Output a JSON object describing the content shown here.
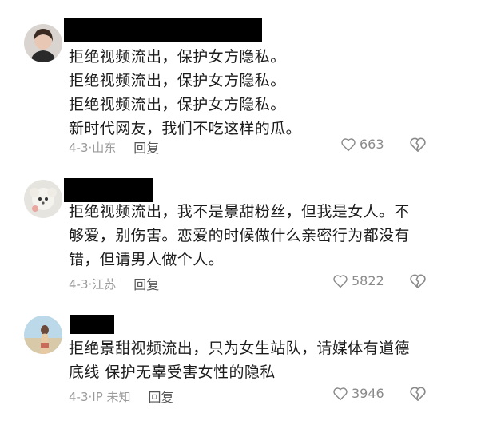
{
  "comments": [
    {
      "lines": "拒绝视频流出，保护女方隐私。\n拒绝视频流出，保护女方隐私。\n拒绝视频流出，保护女方隐私。\n新时代网友，我们不吃这样的瓜。",
      "date": "4-3·山东",
      "reply": "回复",
      "likes": "663"
    },
    {
      "lines": "拒绝视频流出，我不是景甜粉丝，但我是女人。不\n够爱，别伤害。恋爱的时候做什么亲密行为都没有\n错，但请男人做个人。",
      "date": "4-3·江苏",
      "reply": "回复",
      "likes": "5822"
    },
    {
      "lines": "拒绝景甜视频流出，只为女生站队，请媒体有道德\n底线 保护无辜受害女性的隐私",
      "date": "4-3·IP 未知",
      "reply": "回复",
      "likes": "3946"
    }
  ],
  "icons": {
    "like": "heart-outline-icon",
    "dislike": "broken-heart-icon"
  },
  "colors": {
    "meta_text": "#9a9a9a",
    "redaction": "#000000"
  }
}
